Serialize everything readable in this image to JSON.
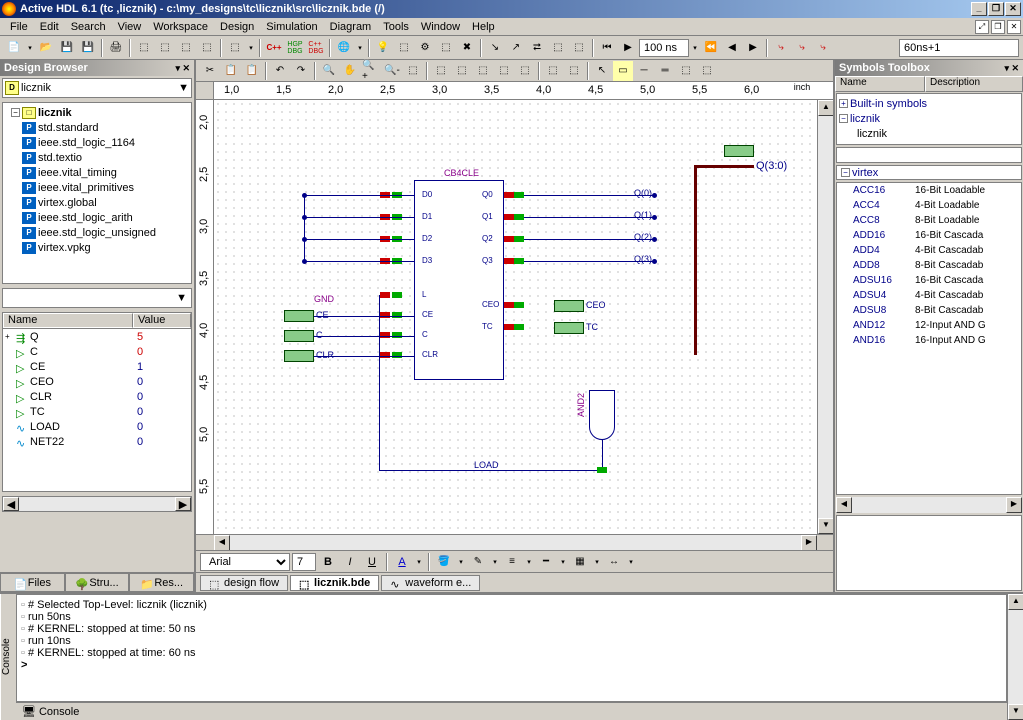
{
  "title": "Active HDL 6.1 (tc ,licznik) - c:\\my_designs\\tc\\licznik\\src\\licznik.bde (/)",
  "menu": [
    "File",
    "Edit",
    "Search",
    "View",
    "Workspace",
    "Design",
    "Simulation",
    "Diagram",
    "Tools",
    "Window",
    "Help"
  ],
  "toolbar": {
    "time_value": "100 ns",
    "step_value": "60ns+1"
  },
  "left_panel": {
    "title": "Design Browser",
    "design_combo": "licznik",
    "tree": [
      {
        "type": "lib",
        "label": "licznik",
        "expand": "−"
      },
      {
        "type": "pkg",
        "label": "std.standard"
      },
      {
        "type": "pkg",
        "label": "ieee.std_logic_1164"
      },
      {
        "type": "pkg",
        "label": "std.textio"
      },
      {
        "type": "pkg",
        "label": "ieee.vital_timing"
      },
      {
        "type": "pkg",
        "label": "ieee.vital_primitives"
      },
      {
        "type": "pkg",
        "label": "virtex.global"
      },
      {
        "type": "pkg",
        "label": "ieee.std_logic_arith"
      },
      {
        "type": "pkg",
        "label": "ieee.std_logic_unsigned"
      },
      {
        "type": "pkg",
        "label": "virtex.vpkg"
      }
    ],
    "sig_header": [
      "Name",
      "Value"
    ],
    "signals": [
      {
        "name": "Q",
        "value": "5",
        "expand": "+",
        "color": "red",
        "icon": "bus"
      },
      {
        "name": "C",
        "value": "0",
        "color": "red",
        "icon": "in"
      },
      {
        "name": "CE",
        "value": "1",
        "color": "blue",
        "icon": "in"
      },
      {
        "name": "CEO",
        "value": "0",
        "color": "blue",
        "icon": "out"
      },
      {
        "name": "CLR",
        "value": "0",
        "color": "blue",
        "icon": "in"
      },
      {
        "name": "TC",
        "value": "0",
        "color": "blue",
        "icon": "out"
      },
      {
        "name": "LOAD",
        "value": "0",
        "color": "blue",
        "icon": "net"
      },
      {
        "name": "NET22",
        "value": "0",
        "color": "blue",
        "icon": "net"
      }
    ],
    "tabs": [
      "Files",
      "Stru...",
      "Res..."
    ]
  },
  "center": {
    "ruler_unit": "inch",
    "ruler_vals": [
      "1,0",
      "1,5",
      "2,0",
      "2,5",
      "3,0",
      "3,5",
      "4,0",
      "4,5",
      "5,0",
      "5,5",
      "6,0"
    ],
    "vruler_vals": [
      "2,0",
      "2,5",
      "3,0",
      "3,5",
      "4,0",
      "4,5",
      "5,0",
      "5,5"
    ],
    "format_font": "Arial",
    "format_size": "7",
    "tabs": [
      {
        "label": "design flow",
        "active": false
      },
      {
        "label": "licznik.bde",
        "active": true
      },
      {
        "label": "waveform e...",
        "active": false
      }
    ],
    "schematic": {
      "component": "CB4CLE",
      "pins_left": [
        "D0",
        "D1",
        "D2",
        "D3",
        "L",
        "CE",
        "C",
        "CLR"
      ],
      "pins_right": [
        "Q0",
        "Q1",
        "Q2",
        "Q3",
        "CEO",
        "TC"
      ],
      "ports_in": [
        "CE",
        "C",
        "CLR"
      ],
      "gnd_label": "GND",
      "load_label": "LOAD",
      "gate_label": "AND2",
      "bus_out": "Q(3:0)",
      "nets_out": [
        "Q(0)",
        "Q(1)",
        "Q(2)",
        "Q(3)"
      ],
      "ports_out": [
        "CEO",
        "TC"
      ]
    }
  },
  "right_panel": {
    "title": "Symbols Toolbox",
    "header": [
      "Name",
      "Description"
    ],
    "tree": [
      {
        "label": "Built-in symbols",
        "expand": "+"
      },
      {
        "label": "licznik",
        "expand": "−"
      }
    ],
    "filter_item": "licznik",
    "cat": {
      "label": "virtex",
      "expand": "−"
    },
    "items": [
      {
        "name": "ACC16",
        "desc": "16-Bit Loadable"
      },
      {
        "name": "ACC4",
        "desc": "4-Bit Loadable"
      },
      {
        "name": "ACC8",
        "desc": "8-Bit Loadable"
      },
      {
        "name": "ADD16",
        "desc": "16-Bit Cascada"
      },
      {
        "name": "ADD4",
        "desc": "4-Bit Cascadab"
      },
      {
        "name": "ADD8",
        "desc": "8-Bit Cascadab"
      },
      {
        "name": "ADSU16",
        "desc": "16-Bit Cascada"
      },
      {
        "name": "ADSU4",
        "desc": "4-Bit Cascadab"
      },
      {
        "name": "ADSU8",
        "desc": "8-Bit Cascadab"
      },
      {
        "name": "AND12",
        "desc": "12-Input AND G"
      },
      {
        "name": "AND16",
        "desc": "16-Input AND G"
      }
    ]
  },
  "console": {
    "label": "Console",
    "lines": [
      "# Selected Top-Level: licznik (licznik)",
      "run 50ns",
      "# KERNEL: stopped at time: 50 ns",
      "run 10ns",
      "# KERNEL: stopped at time: 60 ns"
    ],
    "prompt": ">",
    "tab_label": "Console"
  }
}
